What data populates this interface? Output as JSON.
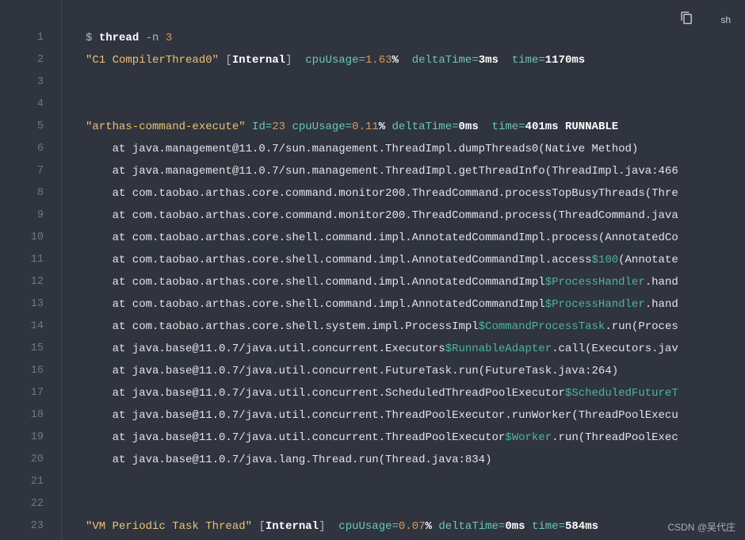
{
  "toolbar": {
    "lang": "sh"
  },
  "watermark": "CSDN @吴代庄",
  "gutter": [
    "1",
    "2",
    "3",
    "4",
    "5",
    "6",
    "7",
    "8",
    "9",
    "10",
    "11",
    "12",
    "13",
    "14",
    "15",
    "16",
    "17",
    "18",
    "19",
    "20",
    "21",
    "22",
    "23"
  ],
  "lines": [
    {
      "tokens": [
        {
          "t": "$ ",
          "c": "c-grey"
        },
        {
          "t": "thread ",
          "c": "c-white"
        },
        {
          "t": "-n ",
          "c": "c-grey"
        },
        {
          "t": "3",
          "c": "c-num"
        }
      ]
    },
    {
      "tokens": [
        {
          "t": "\"C1 CompilerThread0\"",
          "c": "c-yellow"
        },
        {
          "t": " [",
          "c": "c-grey"
        },
        {
          "t": "Internal",
          "c": "c-white"
        },
        {
          "t": "] ",
          "c": "c-grey"
        },
        {
          "t": " cpuUsage=",
          "c": "c-aqua"
        },
        {
          "t": "1.63",
          "c": "c-num"
        },
        {
          "t": "% ",
          "c": "c-white"
        },
        {
          "t": " deltaTime=",
          "c": "c-aqua"
        },
        {
          "t": "3ms ",
          "c": "c-white"
        },
        {
          "t": " time=",
          "c": "c-aqua"
        },
        {
          "t": "1170ms",
          "c": "c-white"
        }
      ]
    },
    {
      "tokens": []
    },
    {
      "tokens": []
    },
    {
      "tokens": [
        {
          "t": "\"arthas-command-execute\"",
          "c": "c-yellow"
        },
        {
          "t": " Id=",
          "c": "c-aqua"
        },
        {
          "t": "23",
          "c": "c-num"
        },
        {
          "t": " cpuUsage=",
          "c": "c-aqua"
        },
        {
          "t": "0.11",
          "c": "c-num"
        },
        {
          "t": "%",
          "c": "c-white"
        },
        {
          "t": " deltaTime=",
          "c": "c-aqua"
        },
        {
          "t": "0ms",
          "c": "c-white"
        },
        {
          "t": "  time=",
          "c": "c-aqua"
        },
        {
          "t": "401ms RUNNABLE",
          "c": "c-white"
        }
      ]
    },
    {
      "tokens": [
        {
          "t": "    at java.management@11.0.7/sun.management.ThreadImpl.dumpThreads0(Native Method)",
          "c": "c-plain"
        }
      ]
    },
    {
      "tokens": [
        {
          "t": "    at java.management@11.0.7/sun.management.ThreadImpl.getThreadInfo(ThreadImpl.java:466",
          "c": "c-plain"
        }
      ]
    },
    {
      "tokens": [
        {
          "t": "    at com.taobao.arthas.core.command.monitor200.ThreadCommand.processTopBusyThreads(Thre",
          "c": "c-plain"
        }
      ]
    },
    {
      "tokens": [
        {
          "t": "    at com.taobao.arthas.core.command.monitor200.ThreadCommand.process(ThreadCommand.java",
          "c": "c-plain"
        }
      ]
    },
    {
      "tokens": [
        {
          "t": "    at com.taobao.arthas.core.shell.command.impl.AnnotatedCommandImpl.process(AnnotatedCo",
          "c": "c-plain"
        }
      ]
    },
    {
      "tokens": [
        {
          "t": "    at com.taobao.arthas.core.shell.command.impl.AnnotatedCommandImpl.access",
          "c": "c-plain"
        },
        {
          "t": "$100",
          "c": "c-teal"
        },
        {
          "t": "(Annotate",
          "c": "c-plain"
        }
      ]
    },
    {
      "tokens": [
        {
          "t": "    at com.taobao.arthas.core.shell.command.impl.AnnotatedCommandImpl",
          "c": "c-plain"
        },
        {
          "t": "$ProcessHandler",
          "c": "c-teal"
        },
        {
          "t": ".hand",
          "c": "c-plain"
        }
      ]
    },
    {
      "tokens": [
        {
          "t": "    at com.taobao.arthas.core.shell.command.impl.AnnotatedCommandImpl",
          "c": "c-plain"
        },
        {
          "t": "$ProcessHandler",
          "c": "c-teal"
        },
        {
          "t": ".hand",
          "c": "c-plain"
        }
      ]
    },
    {
      "tokens": [
        {
          "t": "    at com.taobao.arthas.core.shell.system.impl.ProcessImpl",
          "c": "c-plain"
        },
        {
          "t": "$CommandProcessTask",
          "c": "c-teal"
        },
        {
          "t": ".run(Proces",
          "c": "c-plain"
        }
      ]
    },
    {
      "tokens": [
        {
          "t": "    at java.base@11.0.7/java.util.concurrent.Executors",
          "c": "c-plain"
        },
        {
          "t": "$RunnableAdapter",
          "c": "c-teal"
        },
        {
          "t": ".call(Executors.jav",
          "c": "c-plain"
        }
      ]
    },
    {
      "tokens": [
        {
          "t": "    at java.base@11.0.7/java.util.concurrent.FutureTask.run(FutureTask.java:264)",
          "c": "c-plain"
        }
      ]
    },
    {
      "tokens": [
        {
          "t": "    at java.base@11.0.7/java.util.concurrent.ScheduledThreadPoolExecutor",
          "c": "c-plain"
        },
        {
          "t": "$ScheduledFutureT",
          "c": "c-teal"
        }
      ]
    },
    {
      "tokens": [
        {
          "t": "    at java.base@11.0.7/java.util.concurrent.ThreadPoolExecutor.runWorker(ThreadPoolExecu",
          "c": "c-plain"
        }
      ]
    },
    {
      "tokens": [
        {
          "t": "    at java.base@11.0.7/java.util.concurrent.ThreadPoolExecutor",
          "c": "c-plain"
        },
        {
          "t": "$Worker",
          "c": "c-teal"
        },
        {
          "t": ".run(ThreadPoolExec",
          "c": "c-plain"
        }
      ]
    },
    {
      "tokens": [
        {
          "t": "    at java.base@11.0.7/java.lang.Thread.run(Thread.java:834)",
          "c": "c-plain"
        }
      ]
    },
    {
      "tokens": []
    },
    {
      "tokens": []
    },
    {
      "tokens": [
        {
          "t": "\"VM Periodic Task Thread\"",
          "c": "c-yellow"
        },
        {
          "t": " [",
          "c": "c-grey"
        },
        {
          "t": "Internal",
          "c": "c-white"
        },
        {
          "t": "] ",
          "c": "c-grey"
        },
        {
          "t": " cpuUsage=",
          "c": "c-aqua"
        },
        {
          "t": "0.07",
          "c": "c-num"
        },
        {
          "t": "%",
          "c": "c-white"
        },
        {
          "t": " deltaTime=",
          "c": "c-aqua"
        },
        {
          "t": "0ms",
          "c": "c-white"
        },
        {
          "t": " time=",
          "c": "c-aqua"
        },
        {
          "t": "584ms",
          "c": "c-white"
        }
      ]
    }
  ]
}
